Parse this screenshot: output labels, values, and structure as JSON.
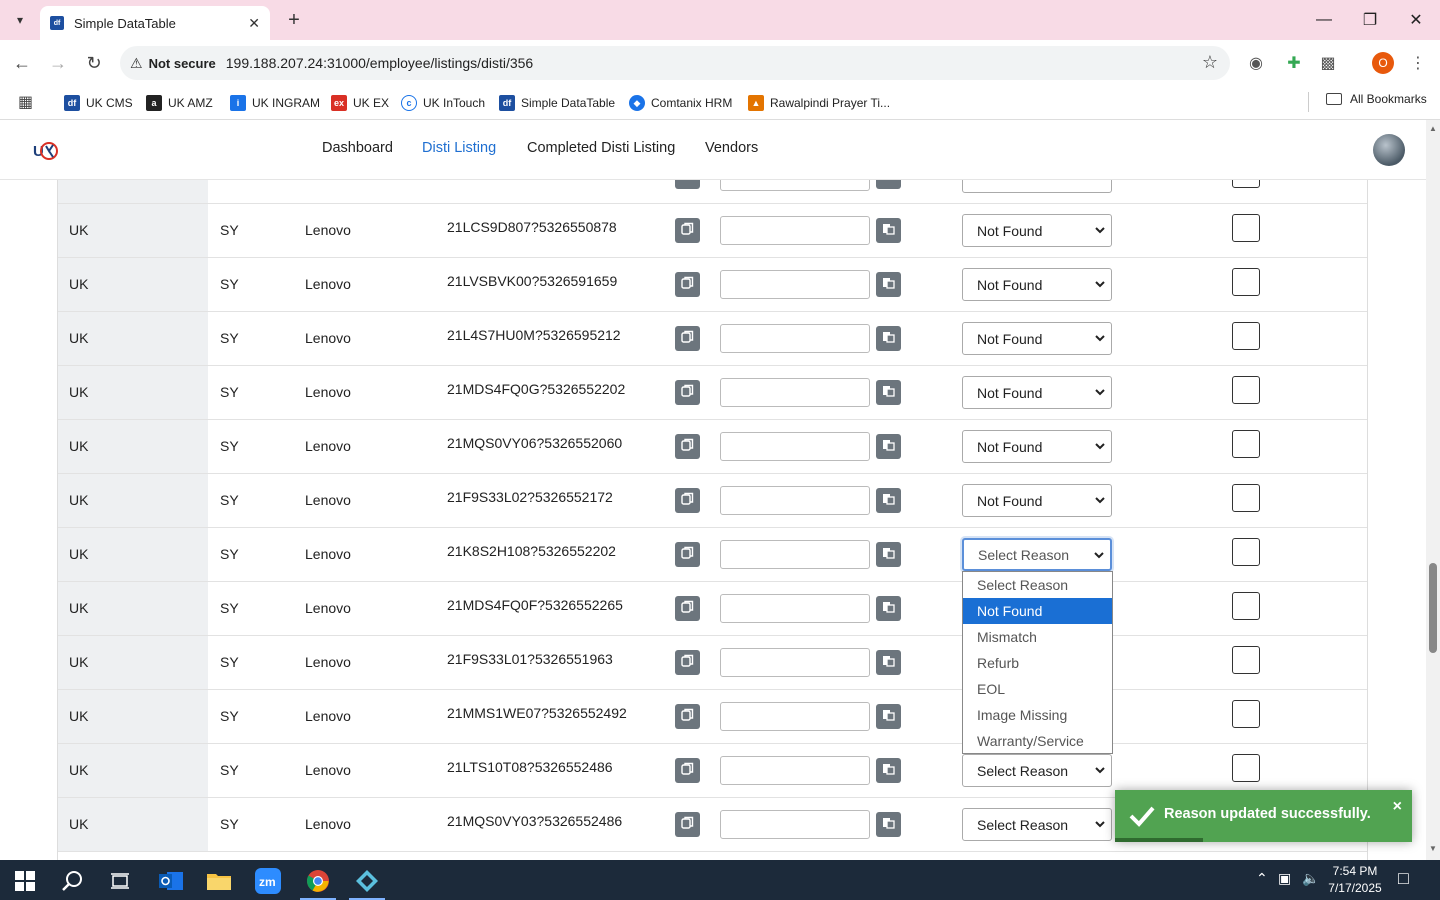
{
  "browser": {
    "tab_title": "Simple DataTable",
    "favicon_text": "df",
    "not_secure": "Not secure",
    "url": "199.188.207.24:31000/employee/listings/disti/356",
    "profile_initial": "O",
    "bookmarks": [
      {
        "label": "UK CMS",
        "icon": "df-icon",
        "color": "#1d4fa0"
      },
      {
        "label": "UK AMZ",
        "icon": "amazon-icon",
        "color": "#222222"
      },
      {
        "label": "UK INGRAM",
        "icon": "ingram-icon",
        "color": "#1a73e8"
      },
      {
        "label": "UK EX",
        "icon": "ex-icon",
        "color": "#d93025"
      },
      {
        "label": "UK InTouch",
        "icon": "intouch-icon",
        "color": "#1a73e8"
      },
      {
        "label": "Simple DataTable",
        "icon": "df-icon",
        "color": "#1d4fa0"
      },
      {
        "label": "Comtanix HRM",
        "icon": "comtanix-icon",
        "color": "#1a73e8"
      },
      {
        "label": "Rawalpindi Prayer Ti...",
        "icon": "prayer-icon",
        "color": "#e37400"
      }
    ],
    "all_bookmarks": "All Bookmarks"
  },
  "app": {
    "nav": [
      "Dashboard",
      "Disti Listing",
      "Completed Disti Listing",
      "Vendors"
    ],
    "active_nav": "Disti Listing"
  },
  "rows": [
    {
      "region": "UK",
      "code": "SY",
      "brand": "Lenovo",
      "sku": "21LCS9D807?5326550878",
      "reason": "Not Found"
    },
    {
      "region": "UK",
      "code": "SY",
      "brand": "Lenovo",
      "sku": "21LVSBVK00?5326591659",
      "reason": "Not Found"
    },
    {
      "region": "UK",
      "code": "SY",
      "brand": "Lenovo",
      "sku": "21L4S7HU0M?5326595212",
      "reason": "Not Found"
    },
    {
      "region": "UK",
      "code": "SY",
      "brand": "Lenovo",
      "sku": "21MDS4FQ0G?5326552202",
      "reason": "Not Found"
    },
    {
      "region": "UK",
      "code": "SY",
      "brand": "Lenovo",
      "sku": "21MQS0VY06?5326552060",
      "reason": "Not Found"
    },
    {
      "region": "UK",
      "code": "SY",
      "brand": "Lenovo",
      "sku": "21F9S33L02?5326552172",
      "reason": "Not Found"
    },
    {
      "region": "UK",
      "code": "SY",
      "brand": "Lenovo",
      "sku": "21K8S2H108?5326552202",
      "reason": "Select Reason"
    },
    {
      "region": "UK",
      "code": "SY",
      "brand": "Lenovo",
      "sku": "21MDS4FQ0F?5326552265",
      "reason": ""
    },
    {
      "region": "UK",
      "code": "SY",
      "brand": "Lenovo",
      "sku": "21F9S33L01?5326551963",
      "reason": ""
    },
    {
      "region": "UK",
      "code": "SY",
      "brand": "Lenovo",
      "sku": "21MMS1WE07?5326552492",
      "reason": ""
    },
    {
      "region": "UK",
      "code": "SY",
      "brand": "Lenovo",
      "sku": "21LTS10T08?5326552486",
      "reason": "Select Reason"
    },
    {
      "region": "UK",
      "code": "SY",
      "brand": "Lenovo",
      "sku": "21MQS0VY03?5326552486",
      "reason": "Select Reason"
    }
  ],
  "dropdown": {
    "options": [
      "Select Reason",
      "Not Found",
      "Mismatch",
      "Refurb",
      "EOL",
      "Image Missing",
      "Warranty/Service"
    ],
    "highlighted": "Not Found"
  },
  "toast": {
    "message": "Reason updated successfully.",
    "close": "×"
  },
  "taskbar": {
    "time": "7:54 PM",
    "date": "7/17/2025"
  },
  "colors": {
    "accent": "#1f6fd1",
    "highlight": "#1a6fd4",
    "toast_bg": "#51a351",
    "icon_btn": "#6c757d",
    "tab_strip": "#f8dbe6"
  }
}
